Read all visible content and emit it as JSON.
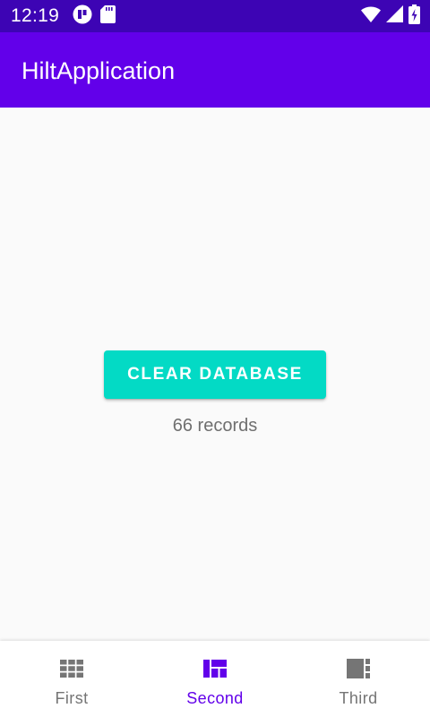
{
  "status_bar": {
    "time": "12:19",
    "icons": [
      "notification-app-icon",
      "sd-card-icon",
      "wifi-icon",
      "cell-signal-icon",
      "battery-icon"
    ],
    "background": "#3d04b4"
  },
  "app_bar": {
    "title": "HiltApplication",
    "background": "#6200ea"
  },
  "main": {
    "clear_button_label": "CLEAR DATABASE",
    "records_text": "66 records",
    "button_color": "#03dac5"
  },
  "bottom_nav": {
    "active_color": "#6200ea",
    "inactive_color": "#757575",
    "items": [
      {
        "label": "First",
        "icon": "grid-icon",
        "active": false
      },
      {
        "label": "Second",
        "icon": "dashboard-icon",
        "active": true
      },
      {
        "label": "Third",
        "icon": "layout-icon",
        "active": false
      }
    ]
  }
}
